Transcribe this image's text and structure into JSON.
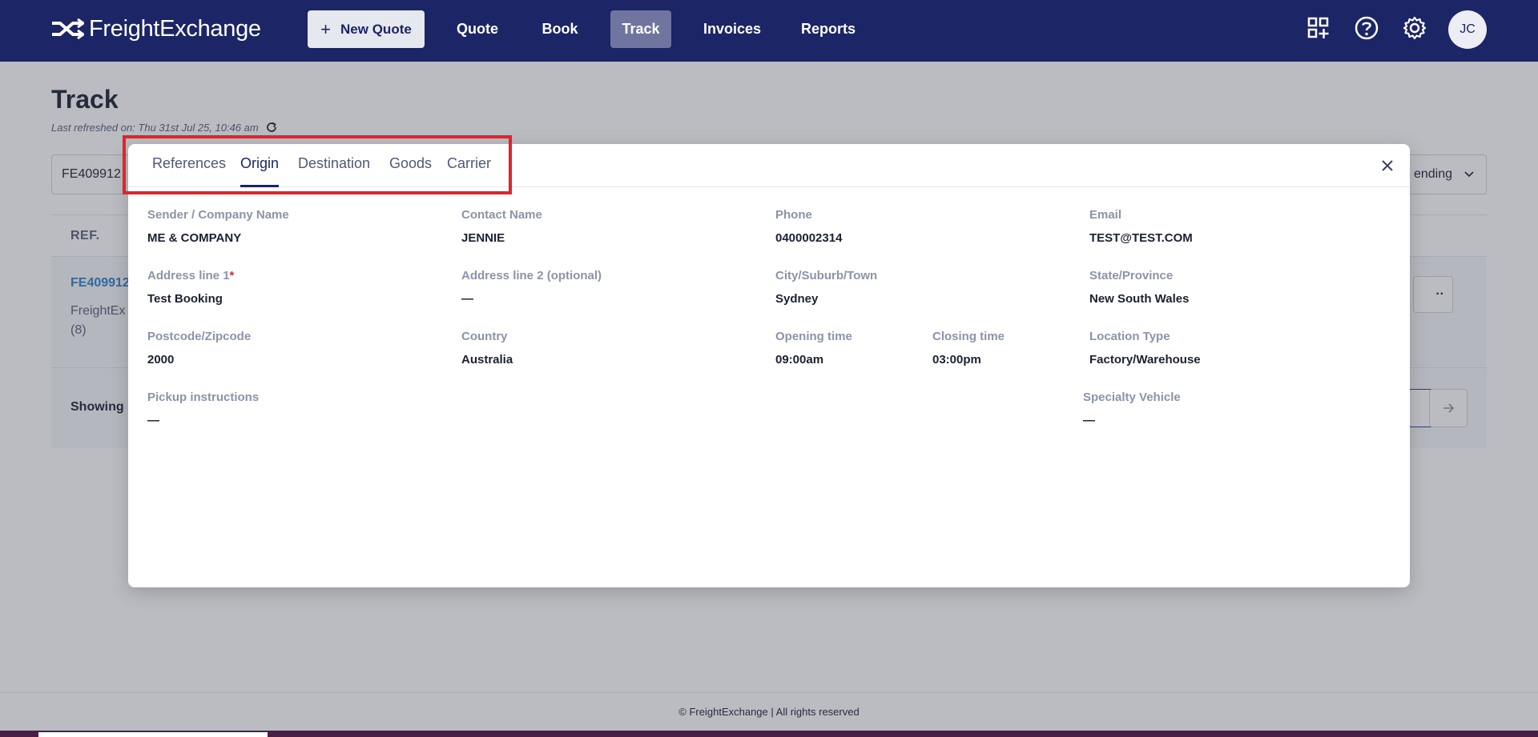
{
  "nav": {
    "brand": "FreightExchange",
    "new_quote": "New Quote",
    "links": [
      "Quote",
      "Book",
      "Track",
      "Invoices",
      "Reports"
    ],
    "active": "Track",
    "avatar_initials": "JC"
  },
  "page": {
    "title": "Track",
    "last_refreshed": "Last refreshed on: Thu 31st Jul 25, 10:46 am",
    "search_value": "FE409912",
    "sort_label": "ending",
    "column_ref": "REF.",
    "row_ref": "FE409912",
    "row_sub_line1": "FreightEx",
    "row_sub_line2": "(8)",
    "row_more": "··",
    "showing_label": "Showing",
    "copyright": "© FreightExchange | All rights reserved"
  },
  "modal": {
    "tabs": [
      "References",
      "Origin",
      "Destination",
      "Goods",
      "Carrier"
    ],
    "active_tab": "Origin",
    "fields": {
      "sender": {
        "label": "Sender / Company Name",
        "value": "ME & COMPANY"
      },
      "contact": {
        "label": "Contact Name",
        "value": "JENNIE"
      },
      "phone": {
        "label": "Phone",
        "value": "0400002314"
      },
      "email": {
        "label": "Email",
        "value": "TEST@TEST.COM"
      },
      "address1": {
        "label": "Address line 1",
        "required_mark": "*",
        "value": "Test Booking"
      },
      "address2": {
        "label": "Address line 2 (optional)",
        "value": "—"
      },
      "city": {
        "label": "City/Suburb/Town",
        "value": "Sydney"
      },
      "state": {
        "label": "State/Province",
        "value": "New South Wales"
      },
      "postcode": {
        "label": "Postcode/Zipcode",
        "value": "2000"
      },
      "country": {
        "label": "Country",
        "value": "Australia"
      },
      "opening": {
        "label": "Opening time",
        "value": "09:00am"
      },
      "closing": {
        "label": "Closing time",
        "value": "03:00pm"
      },
      "location_type": {
        "label": "Location Type",
        "value": "Factory/Warehouse"
      },
      "pickup": {
        "label": "Pickup instructions",
        "value": "—"
      },
      "specialty": {
        "label": "Specialty Vehicle",
        "value": "—"
      }
    }
  },
  "colors": {
    "nav_bg": "#1c2566",
    "nav_active": "#6f759f",
    "highlight": "#e0242a",
    "link_blue": "#2f80c9"
  },
  "icons": [
    "logo-mark-icon",
    "plus-icon",
    "apps-add-icon",
    "help-icon",
    "gear-icon",
    "refresh-icon",
    "chevron-down-icon",
    "close-icon",
    "arrow-right-icon"
  ]
}
